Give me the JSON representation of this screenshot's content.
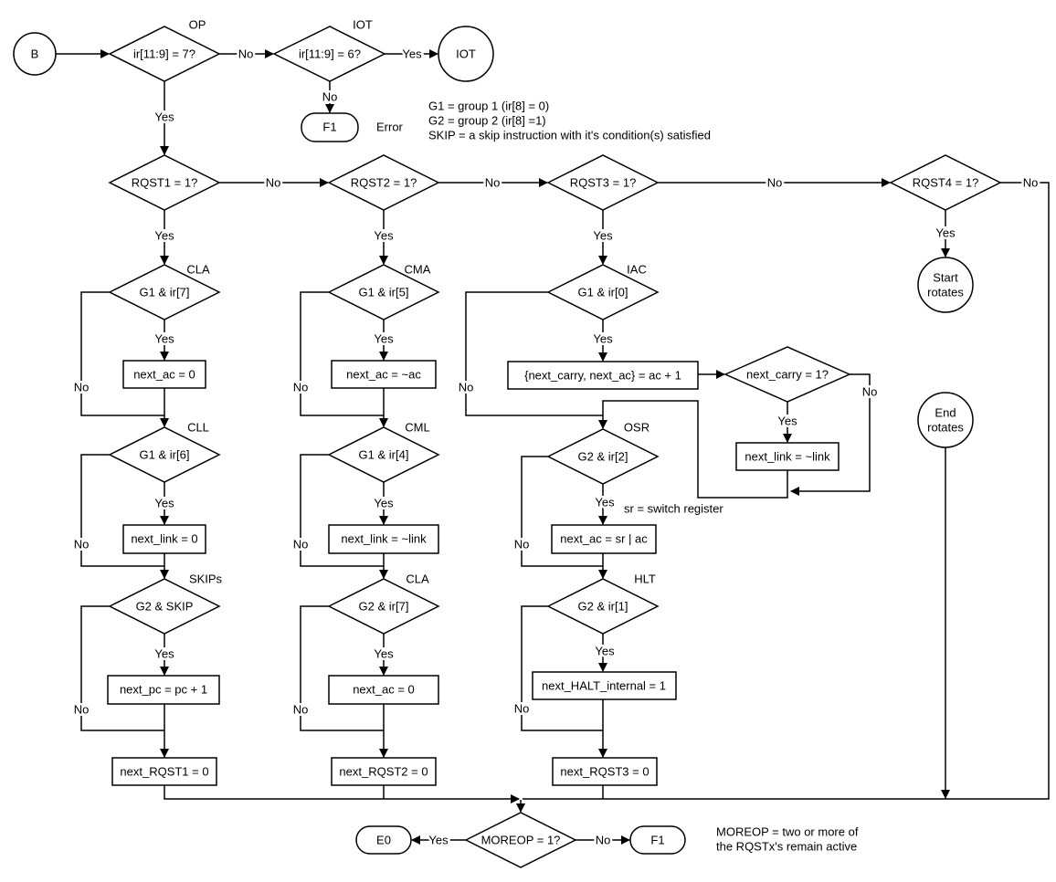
{
  "start": "B",
  "op": {
    "tag": "OP",
    "cond": "ir[11:9] = 7?"
  },
  "iot": {
    "tag": "IOT",
    "cond": "ir[11:9] = 6?",
    "end": "IOT"
  },
  "error": {
    "node": "F1",
    "label": "Error"
  },
  "notes": [
    "G1 = group 1 (ir[8] = 0)",
    "G2 = group 2 (ir[8]  =1)",
    "SKIP = a skip instruction with it's condition(s) satisfied"
  ],
  "edges": {
    "yes": "Yes",
    "no": "No"
  },
  "rqst": [
    "RQST1 = 1?",
    "RQST2 = 1?",
    "RQST3 = 1?",
    "RQST4 = 1?"
  ],
  "col1": {
    "cla_tag": "CLA",
    "cla_cond": "G1 & ir[7]",
    "cla_action": "next_ac = 0",
    "cll_tag": "CLL",
    "cll_cond": "G1 & ir[6]",
    "cll_action": "next_link = 0",
    "skip_tag": "SKIPs",
    "skip_cond": "G2 & SKIP",
    "skip_action": "next_pc = pc + 1",
    "clear": "next_RQST1 = 0"
  },
  "col2": {
    "cma_tag": "CMA",
    "cma_cond": "G1 & ir[5]",
    "cma_action": "next_ac = ~ac",
    "cml_tag": "CML",
    "cml_cond": "G1 & ir[4]",
    "cml_action": "next_link = ~link",
    "cla_tag": "CLA",
    "cla_cond": "G2 & ir[7]",
    "cla_action": "next_ac = 0",
    "clear": "next_RQST2 = 0"
  },
  "col3": {
    "iac_tag": "IAC",
    "iac_cond": "G1 & ir[0]",
    "iac_action": "{next_carry, next_ac} = ac + 1",
    "carry_cond": "next_carry = 1?",
    "carry_action": "next_link = ~link",
    "osr_tag": "OSR",
    "osr_cond": "G2 & ir[2]",
    "osr_note": "sr = switch register",
    "osr_action": "next_ac = sr | ac",
    "hlt_tag": "HLT",
    "hlt_cond": "G2 & ir[1]",
    "hlt_action": "next_HALT_internal = 1",
    "clear": "next_RQST3 = 0"
  },
  "col4": {
    "start": [
      "Start",
      "rotates"
    ],
    "end": [
      "End",
      "rotates"
    ]
  },
  "moreop": {
    "cond": "MOREOP = 1?",
    "yes_node": "E0",
    "no_node": "F1",
    "note": [
      "MOREOP = two or more of",
      "the RQSTx's remain active"
    ]
  }
}
